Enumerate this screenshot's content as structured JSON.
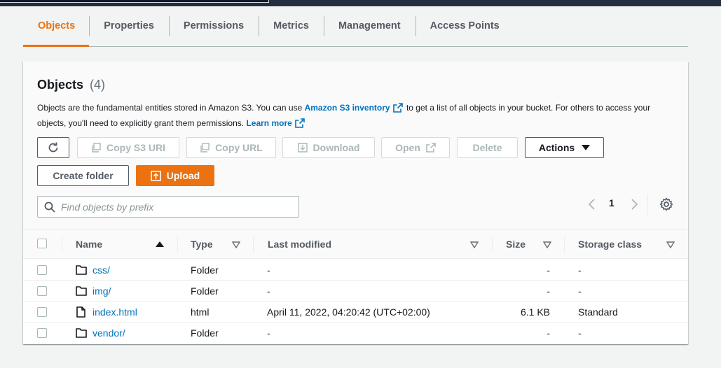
{
  "tabs": [
    {
      "label": "Objects",
      "active": true
    },
    {
      "label": "Properties",
      "active": false
    },
    {
      "label": "Permissions",
      "active": false
    },
    {
      "label": "Metrics",
      "active": false
    },
    {
      "label": "Management",
      "active": false
    },
    {
      "label": "Access Points",
      "active": false
    }
  ],
  "panel": {
    "title": "Objects",
    "count": "(4)",
    "description_part1": "Objects are the fundamental entities stored in Amazon S3. You can use ",
    "inventory_link": "Amazon S3 inventory",
    "description_part2": " to get a list of all objects in your bucket. For others to access your objects, you'll need to explicitly grant them permissions.",
    "learn_more": "Learn more"
  },
  "toolbar": {
    "refresh_icon": "refresh-icon",
    "copy_s3_uri": "Copy S3 URI",
    "copy_url": "Copy URL",
    "download": "Download",
    "open": "Open",
    "delete": "Delete",
    "actions": "Actions",
    "create_folder": "Create folder",
    "upload": "Upload"
  },
  "search": {
    "placeholder": "Find objects by prefix",
    "value": ""
  },
  "pagination": {
    "current_page": "1"
  },
  "table": {
    "columns": {
      "name": "Name",
      "type": "Type",
      "last_modified": "Last modified",
      "size": "Size",
      "storage_class": "Storage class"
    },
    "rows": [
      {
        "icon": "folder-icon",
        "name": "css/",
        "type": "Folder",
        "last_modified": "-",
        "size": "-",
        "storage_class": "-"
      },
      {
        "icon": "folder-icon",
        "name": "img/",
        "type": "Folder",
        "last_modified": "-",
        "size": "-",
        "storage_class": "-"
      },
      {
        "icon": "file-icon",
        "name": "index.html",
        "type": "html",
        "last_modified": "April 11, 2022, 04:20:42 (UTC+02:00)",
        "size": "6.1 KB",
        "storage_class": "Standard"
      },
      {
        "icon": "folder-icon",
        "name": "vendor/",
        "type": "Folder",
        "last_modified": "-",
        "size": "-",
        "storage_class": "-"
      }
    ]
  },
  "colors": {
    "accent": "#ec7211",
    "link": "#0073bb",
    "topbar": "#232f3e"
  }
}
